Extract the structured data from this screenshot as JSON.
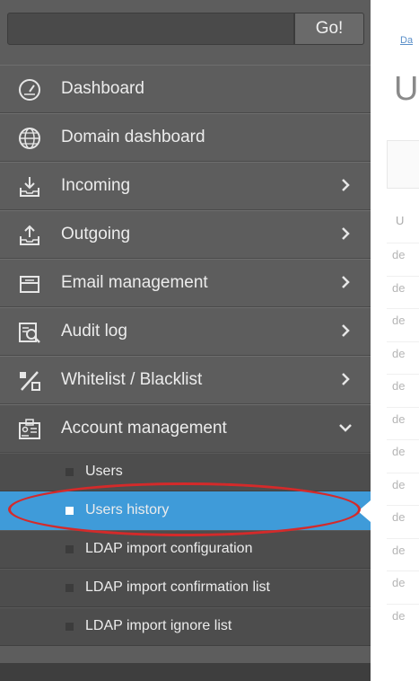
{
  "search": {
    "go_label": "Go!"
  },
  "nav": {
    "items": [
      {
        "name": "dashboard",
        "label": "Dashboard",
        "icon": "dashboard-gauge-icon",
        "has_chevron": false
      },
      {
        "name": "domain-dashboard",
        "label": "Domain dashboard",
        "icon": "globe-icon",
        "has_chevron": false
      },
      {
        "name": "incoming",
        "label": "Incoming",
        "icon": "inbox-download-icon",
        "has_chevron": true
      },
      {
        "name": "outgoing",
        "label": "Outgoing",
        "icon": "inbox-upload-icon",
        "has_chevron": true
      },
      {
        "name": "email-management",
        "label": "Email management",
        "icon": "email-tray-icon",
        "has_chevron": true
      },
      {
        "name": "audit-log",
        "label": "Audit log",
        "icon": "audit-search-icon",
        "has_chevron": true
      },
      {
        "name": "whitelist-blacklist",
        "label": "Whitelist / Blacklist",
        "icon": "percent-icon",
        "has_chevron": true
      },
      {
        "name": "account-management",
        "label": "Account management",
        "icon": "account-card-icon",
        "has_chevron": true,
        "expanded": true
      }
    ],
    "sub_items": [
      {
        "name": "users",
        "label": "Users",
        "selected": false
      },
      {
        "name": "users-history",
        "label": "Users history",
        "selected": true
      },
      {
        "name": "ldap-import-configuration",
        "label": "LDAP import configuration",
        "selected": false
      },
      {
        "name": "ldap-import-confirmation-list",
        "label": "LDAP import confirmation list",
        "selected": false
      },
      {
        "name": "ldap-import-ignore-list",
        "label": "LDAP import ignore list",
        "selected": false
      }
    ]
  },
  "content": {
    "breadcrumb": "Da",
    "title": "U",
    "column_header": "U",
    "rows": [
      "de",
      "de",
      "de",
      "de",
      "de",
      "de",
      "de",
      "de",
      "de",
      "de",
      "de",
      "de"
    ]
  },
  "colors": {
    "sidebar_bg": "#5d5d5d",
    "selected_bg": "#3f9bd9",
    "annotation_red": "#d42a2a"
  }
}
